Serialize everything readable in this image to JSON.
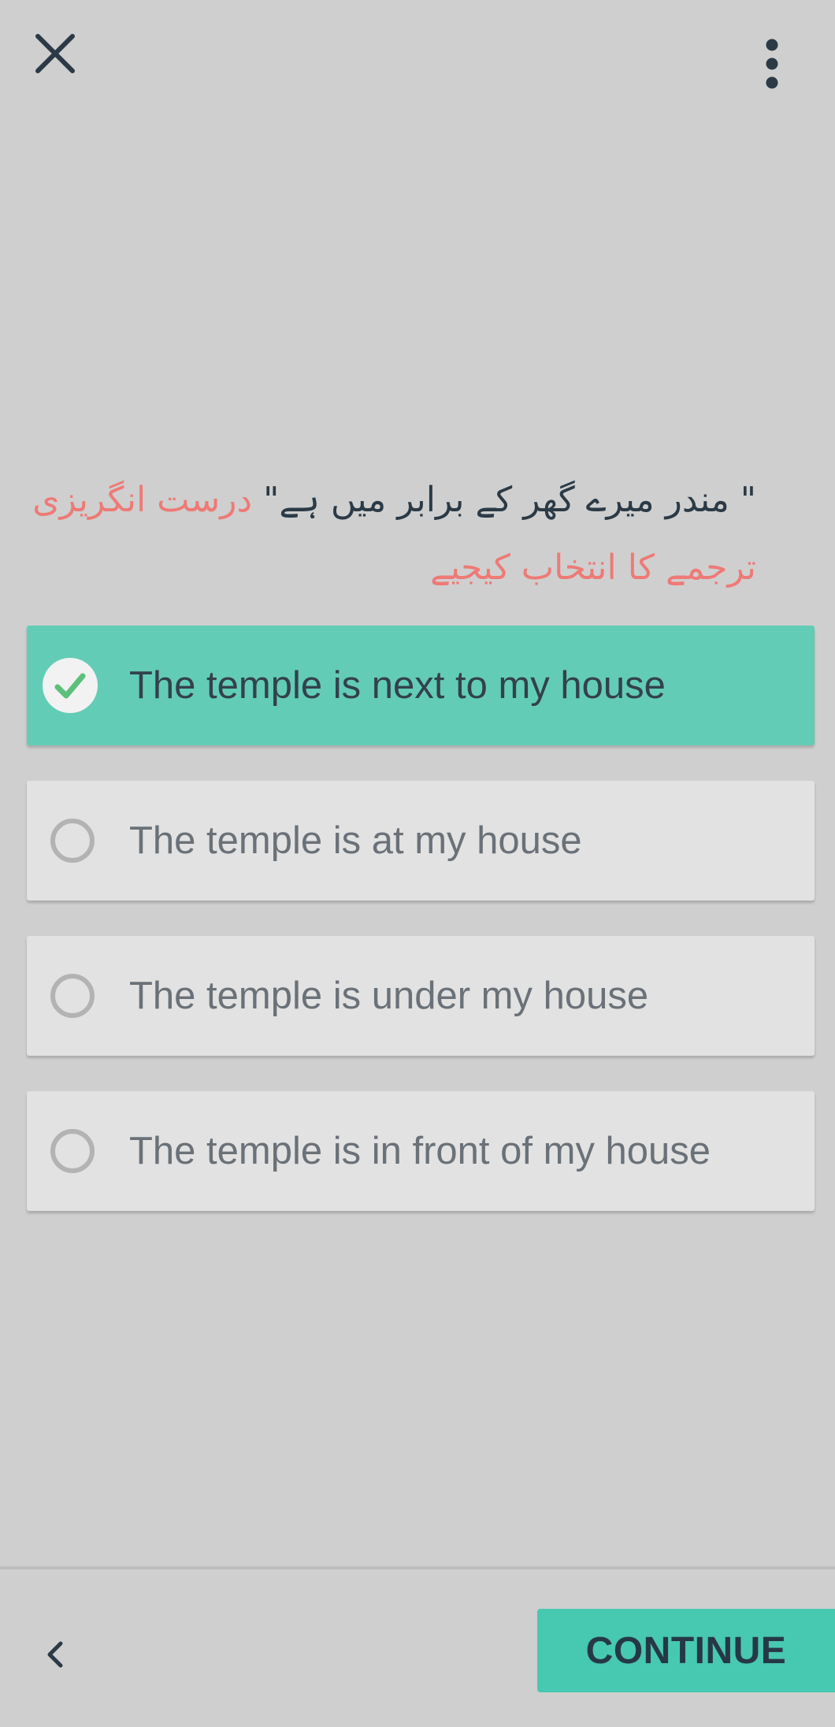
{
  "header": {
    "close_icon": "close-icon",
    "menu_icon": "more-vertical-icon"
  },
  "question": {
    "quote_text": "\" مندر میرے گھر کے برابر میں ہے\"",
    "instruction_text": "درست انگریزی ترجمے کا انتخاب کیجیے",
    "colors": {
      "quote": "#2b3a46",
      "instruction": "#ee7a76"
    }
  },
  "options": [
    {
      "label": "The temple is next to my house",
      "selected": true
    },
    {
      "label": "The temple is at my house",
      "selected": false
    },
    {
      "label": "The temple is under my house",
      "selected": false
    },
    {
      "label": "The temple is in front of my house",
      "selected": false
    }
  ],
  "footer": {
    "back_icon": "chevron-left-icon",
    "continue_label": "CONTINUE"
  },
  "colors": {
    "background": "#cfcfcf",
    "selected_option": "#63ccb6",
    "option": "#e2e2e2",
    "accent_button": "#47c8b0"
  }
}
